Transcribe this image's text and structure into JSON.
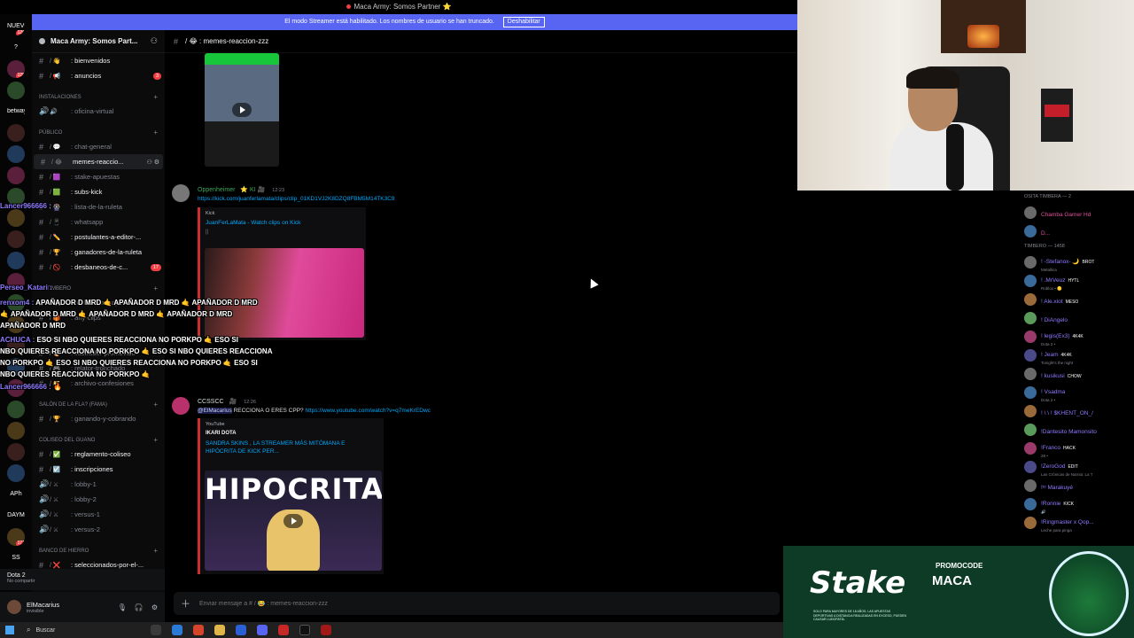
{
  "window": {
    "title": "Maca Army: Somos Partner ⭐"
  },
  "streamer_banner": {
    "text": "El modo Streamer está habilitado. Los nombres de usuario se han truncado.",
    "button": "Deshabilitar"
  },
  "guilds": [
    {
      "label": "NUEVO",
      "badge": "126"
    },
    {
      "label": "?",
      "badge": ""
    },
    {
      "label": "",
      "badge": "120"
    },
    {
      "label": "",
      "badge": ""
    },
    {
      "label": "betway",
      "badge": ""
    },
    {
      "label": "",
      "badge": ""
    },
    {
      "label": "",
      "badge": ""
    },
    {
      "label": "",
      "badge": ""
    },
    {
      "label": "",
      "badge": ""
    },
    {
      "label": "",
      "badge": ""
    },
    {
      "label": "",
      "badge": ""
    },
    {
      "label": "",
      "badge": ""
    },
    {
      "label": "",
      "badge": ""
    },
    {
      "label": "",
      "badge": ""
    },
    {
      "label": "",
      "badge": ""
    },
    {
      "label": "",
      "badge": ""
    },
    {
      "label": "",
      "badge": ""
    },
    {
      "label": "",
      "badge": ""
    },
    {
      "label": "",
      "badge": ""
    },
    {
      "label": "",
      "badge": ""
    },
    {
      "label": "",
      "badge": ""
    },
    {
      "label": "",
      "badge": ""
    },
    {
      "label": "APh",
      "badge": ""
    },
    {
      "label": "DAYM",
      "badge": ""
    },
    {
      "label": "",
      "badge": "171"
    },
    {
      "label": "SS",
      "badge": ""
    },
    {
      "label": "EsdD",
      "badge": ""
    },
    {
      "label": "",
      "badge": ""
    }
  ],
  "server": {
    "name": "Maca Army: Somos Part..."
  },
  "channel_list": [
    {
      "kind": "channel",
      "emoji": "/ 👋",
      "name": ": bienvenidos",
      "count": "",
      "state": "unread"
    },
    {
      "kind": "channel",
      "emoji": "/ 📢",
      "name": ": anuncios",
      "count": "3",
      "state": "unread"
    },
    {
      "kind": "category",
      "name": "INSTALACIONES"
    },
    {
      "kind": "voice",
      "emoji": "🔊",
      "name": ": oficina-virtual",
      "count": "",
      "state": ""
    },
    {
      "kind": "category",
      "name": "PÚBLICO"
    },
    {
      "kind": "channel",
      "emoji": "/ 💬",
      "name": ": chat-general",
      "count": "",
      "state": ""
    },
    {
      "kind": "channel",
      "emoji": "/ 😂",
      "name": "memes-reaccio...",
      "count": "",
      "state": "selected"
    },
    {
      "kind": "channel",
      "emoji": "/ 🟪",
      "name": ": stake-apuestas",
      "count": "",
      "state": ""
    },
    {
      "kind": "channel",
      "emoji": "/ 🟩",
      "name": ": subs-kick",
      "count": "",
      "state": "unread"
    },
    {
      "kind": "channel",
      "emoji": "/ 🎡",
      "name": ": lista-de-la-ruleta",
      "count": "",
      "state": ""
    },
    {
      "kind": "channel",
      "emoji": "/ 📱",
      "name": ": whatsapp",
      "count": "",
      "state": ""
    },
    {
      "kind": "channel",
      "emoji": "/ ✏️",
      "name": ": postulantes-a-editor-...",
      "count": "",
      "state": "unread"
    },
    {
      "kind": "channel",
      "emoji": "/ 🏆",
      "name": ": ganadores-de-la-ruleta",
      "count": "",
      "state": "unread"
    },
    {
      "kind": "channel",
      "emoji": "/ 🚫",
      "name": ": desbaneos-de-c...",
      "count": "17",
      "state": "unread"
    },
    {
      "kind": "category",
      "name": "AL TIMBERO"
    },
    {
      "kind": "channel",
      "emoji": "/ 💸",
      "name": ": reclama-tu-yape",
      "count": "",
      "state": ""
    },
    {
      "kind": "channel",
      "emoji": "/ 🎁",
      "name": ": any-clips",
      "count": "",
      "state": ""
    },
    {
      "kind": "category",
      "name": "CATIVA"
    },
    {
      "kind": "channel",
      "emoji": "/ 🎨",
      "name": ": ilustrador-promovido",
      "count": "",
      "state": ""
    },
    {
      "kind": "channel",
      "emoji": "/ 🎮",
      "name": ": relator-tronchado",
      "count": "",
      "state": ""
    },
    {
      "kind": "channel",
      "emoji": "/ 📁",
      "name": ": archivo-confesiones",
      "count": "",
      "state": ""
    },
    {
      "kind": "category",
      "name": "SALÓN DE LA FLA? (FAMA)"
    },
    {
      "kind": "channel",
      "emoji": "/ 🏆",
      "name": ": ganando-y-cobrando",
      "count": "",
      "state": ""
    },
    {
      "kind": "category",
      "name": "COLISEO DEL GUANO"
    },
    {
      "kind": "channel",
      "emoji": "/ ✅",
      "name": ": reglamento-coliseo",
      "count": "",
      "state": "unread"
    },
    {
      "kind": "channel",
      "emoji": "/ ☑️",
      "name": ": inscripciones",
      "count": "",
      "state": "unread"
    },
    {
      "kind": "voice",
      "emoji": "/ ⚔",
      "name": ": lobby-1",
      "count": "",
      "state": ""
    },
    {
      "kind": "voice",
      "emoji": "/ ⚔",
      "name": ": lobby-2",
      "count": "",
      "state": ""
    },
    {
      "kind": "voice",
      "emoji": "/ ⚔",
      "name": ": versus-1",
      "count": "",
      "state": ""
    },
    {
      "kind": "voice",
      "emoji": "/ ⚔",
      "name": ": versus-2",
      "count": "",
      "state": ""
    },
    {
      "kind": "category",
      "name": "BANCO DE HIERRO"
    },
    {
      "kind": "channel",
      "emoji": "/ ❌",
      "name": ": seleccionados-por-el-...",
      "count": "",
      "state": "unread"
    }
  ],
  "voice_panel": {
    "title": "Dota 2",
    "subtitle": "No compartir"
  },
  "user_panel": {
    "name": "ElMacarius",
    "status": "invisible"
  },
  "chat": {
    "channel_name": "/ 😂 : memes-reaccion-zzz",
    "composer_placeholder": "Enviar mensaje a # / 😂 : memes-reaccion-zzz"
  },
  "messages": [
    {
      "author": "Oppenheimer",
      "badges": "⭐ KI 🎥",
      "time": "12:23",
      "link": "https://kick.com/juanferlamata/clips/clip_01KD1VJ2K8DZQ8FBM5M14TK3C9",
      "embed_provider": "Kick",
      "embed_title": "JuanFerLaMata - Watch clips on Kick",
      "embed_desc": "||"
    },
    {
      "author": "CCSSCC",
      "badges": "🎥",
      "time": "12:26",
      "mention": "@ElMacarius",
      "text": "RECCIONA O ERES CPP?",
      "link": "https://www.youtube.com/watch?v=q7meKrEDwc",
      "embed_provider": "YouTube",
      "embed_author": "IKARI DOTA",
      "embed_title": "SANDRA SKINS , LA STREAMER MÁS MITÓMANA E HIPÓCRITA DE KICK PER...",
      "thumb_text": "HIPOCRITA"
    }
  ],
  "chat_overlay": [
    {
      "user": "Lancer966666 :",
      "text": ""
    },
    {
      "user": "Perseo_Katari :",
      "text": ""
    },
    {
      "user": "renxom4 :",
      "text": "APAÑADOR D MRD 🤙 APAÑADOR D MRD 🤙 APAÑADOR D MRD"
    },
    {
      "user": "",
      "text": "🤙 APAÑADOR D MRD 🤙 APAÑADOR D MRD 🤙 APAÑADOR D MRD"
    },
    {
      "user": "",
      "text": "APAÑADOR D MRD"
    },
    {
      "user": "ACHUCA :",
      "text": "ESO SI NBO QUIERES REACCIONA NO PORKPO 🤙 ESO SI"
    },
    {
      "user": "",
      "text": "NBO QUIERES REACCIONA NO PORKPO 🤙 ESO SI NBO QUIERES REACCIONA"
    },
    {
      "user": "",
      "text": "NO PORKPO 🤙 ESO SI NBO QUIERES REACCIONA NO PORKPO 🤙 ESO SI"
    },
    {
      "user": "",
      "text": "NBO QUIERES REACCIONA NO PORKPO 🤙"
    },
    {
      "user": "Lancer966666 :",
      "text": "🔥"
    }
  ],
  "twitch_chat": {
    "categories": [
      "OSITA TIMBERA — 2",
      "TIMBERO — 1458"
    ],
    "top_users": [
      {
        "name": "Chamba Gamer Hd",
        "tag": "",
        "sub": ""
      },
      {
        "name": "D...",
        "tag": "",
        "sub": ""
      }
    ],
    "users": [
      {
        "name": "! -Stefanox- 🌙",
        "tag": "BROT",
        "sub": "Metallica"
      },
      {
        "name": "! .MrVeuz",
        "tag": "HYTL",
        "sub": "Roblox • 🟡"
      },
      {
        "name": "! Ale.xiot",
        "tag": "MESO",
        "sub": ""
      },
      {
        "name": "! DiAngelo",
        "tag": "",
        "sub": ""
      },
      {
        "name": "! legis(Ex3)",
        "tag": "4K4K",
        "sub": "Dota 2 •"
      },
      {
        "name": "! Jeam",
        "tag": "4K4K",
        "sub": "Tonight's the night"
      },
      {
        "name": "! kusikusi",
        "tag": "CHOW",
        "sub": ""
      },
      {
        "name": "! Vsadma",
        "tag": "",
        "sub": "Dota 2 •"
      },
      {
        "name": "! \\ \\ ! $KHENT_ON_/",
        "tag": "",
        "sub": ""
      },
      {
        "name": "!Dantesito Mamonsito",
        "tag": "",
        "sub": ""
      },
      {
        "name": "!Franco",
        "tag": "HACK",
        "sub": "28 •"
      },
      {
        "name": "!ZeroGod",
        "tag": "EDIT",
        "sub": "Las Crónicas de Narnia: La T"
      },
      {
        "name": "!ᵗᵉ Marakuyé",
        "tag": "",
        "sub": ""
      },
      {
        "name": "!Ronnie",
        "tag": "KICK",
        "sub": "🔊"
      },
      {
        "name": "!Ringmaster x Qop...",
        "tag": "",
        "sub": "Leche para pinga"
      }
    ]
  },
  "ad": {
    "brand": "Stake",
    "promo": "PROMOCODE",
    "code": "MACA",
    "fine": "SOLO PARA MAYORES DE 18 AÑOS. LAS APUESTAS DEPORTIVAS A DISTANCIA REALIZADAS EN EXCESO, PUEDEN CAUSAR LUDOPATÍA."
  },
  "taskbar": {
    "search_placeholder": "Buscar"
  }
}
